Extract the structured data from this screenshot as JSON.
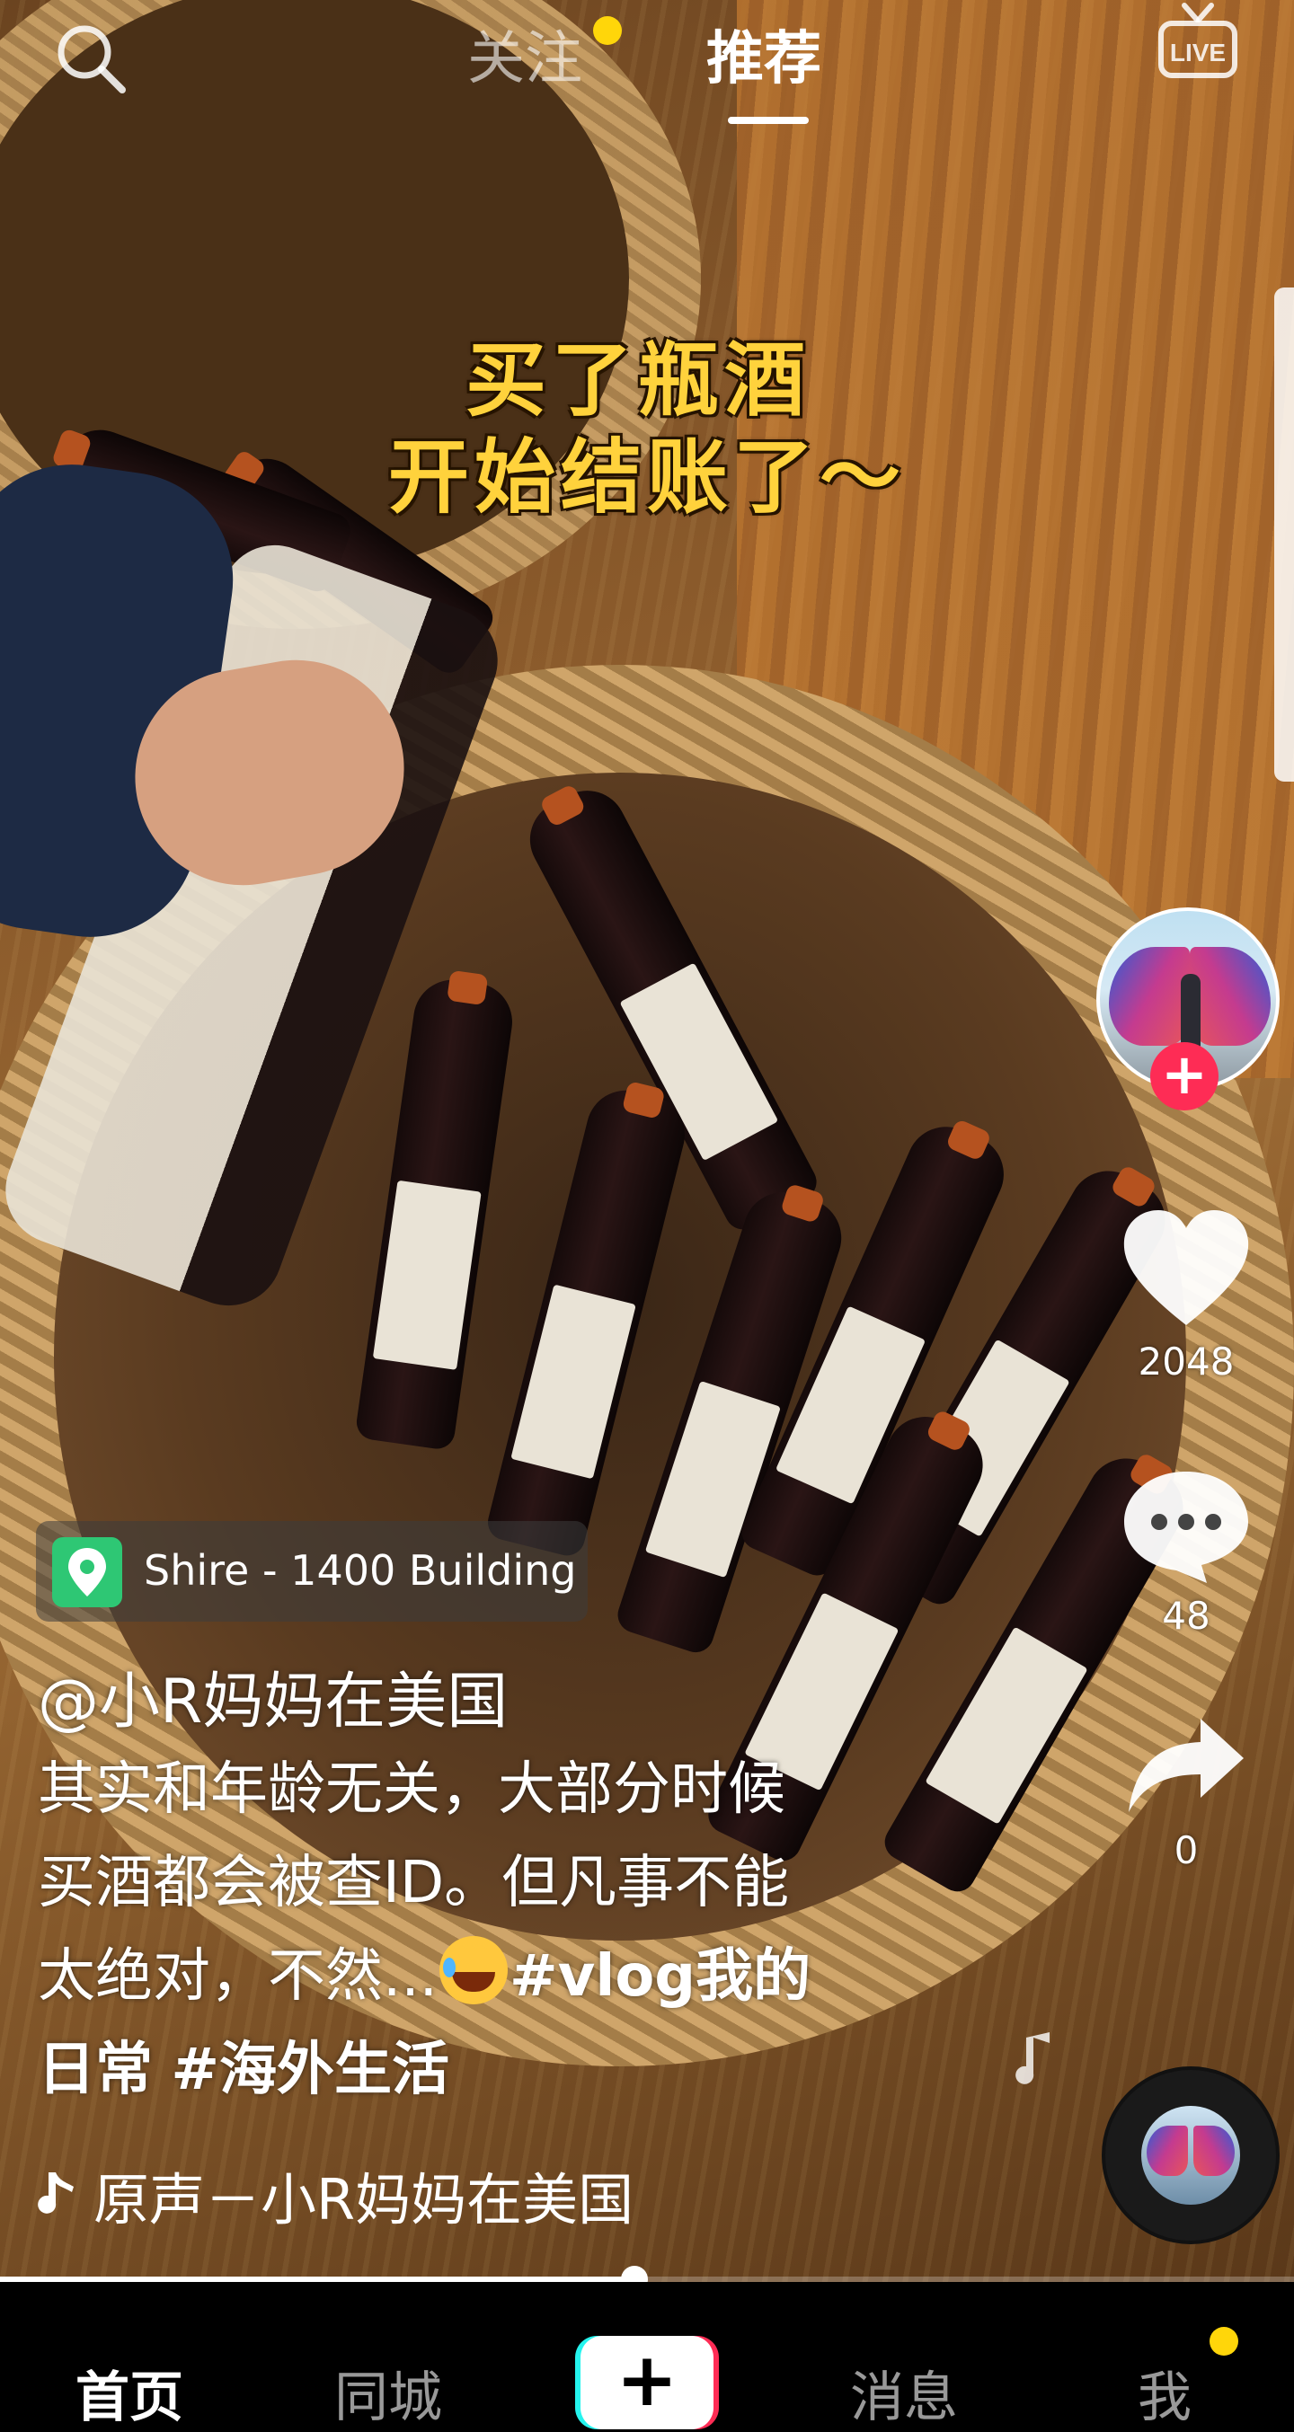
{
  "video": {
    "caption_line1": "买了瓶酒",
    "caption_line2": "开始结账了～"
  },
  "topbar": {
    "search_icon": "search-icon",
    "tab_follow": "关注",
    "tab_recommend": "推荐",
    "live_label": "LIVE",
    "active_tab": "推荐"
  },
  "sidebar": {
    "likes": "2048",
    "comments": "48",
    "shares": "0"
  },
  "post": {
    "location": "Shire - 1400 Building",
    "author": "@小R妈妈在美国",
    "desc_line1": "其实和年龄无关，大部分时候",
    "desc_line2": "买酒都会被查ID。但凡事不能",
    "desc_line3_text": "太绝对，不然...",
    "desc_line3_tag": "#vlog我的",
    "desc_line4_tag1": "日常",
    "desc_line4_tag2": "#海外生活",
    "music": "原声－小R妈妈在美国"
  },
  "progress": {
    "fraction": 0.49
  },
  "bottom_nav": {
    "home": "首页",
    "nearby": "同城",
    "add": "+",
    "messages": "消息",
    "me": "我"
  },
  "colors": {
    "caption": "#ffd23c",
    "accent_red": "#fe2c55",
    "accent_cyan": "#25f4ee",
    "location_green": "#2ec774",
    "notification_dot": "#ffd60a"
  }
}
